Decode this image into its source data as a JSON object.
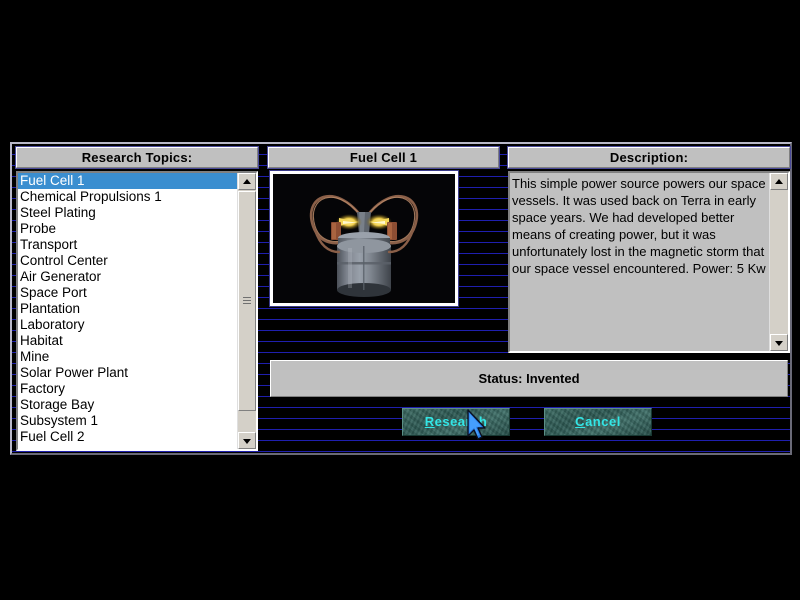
{
  "window": {
    "background_color": "#000000",
    "panel_background_color": "#000000",
    "scanline_color": "#1f1faf",
    "face_color": "#c0c0c0"
  },
  "topics_panel": {
    "header_label": "Research Topics:",
    "selected_index": 0,
    "items": [
      "Fuel Cell 1",
      "Chemical Propulsions 1",
      "Steel Plating",
      "Probe",
      "Transport",
      "Control Center",
      "Air Generator",
      "Space Port",
      "Plantation",
      "Laboratory",
      "Habitat",
      "Mine",
      "Solar Power Plant",
      "Factory",
      "Storage Bay",
      "Subsystem 1",
      "Fuel Cell 2"
    ],
    "scrollbar": {
      "up_arrow_icon": "scroll-up-arrow-icon",
      "down_arrow_icon": "scroll-down-arrow-icon",
      "grip_icon": "scroll-thumb-grip-icon"
    }
  },
  "item_panel": {
    "header_label": "Fuel Cell 1",
    "image_alt": "fuel-cell-render"
  },
  "description_panel": {
    "header_label": "Description:",
    "text": "This simple power source powers our space vessels.  It was used back on Terra in early space years. We had developed better means of creating power, but it was unfortunately lost in the magnetic storm that our space vessel encountered.  Power: 5 Kw",
    "scrollbar": {
      "up_arrow_icon": "scroll-up-arrow-icon",
      "down_arrow_icon": "scroll-down-arrow-icon"
    }
  },
  "status": {
    "label": "Status: Invented"
  },
  "buttons": {
    "research": {
      "accel": "R",
      "rest": "esearch",
      "text_color": "#33e6e6"
    },
    "cancel": {
      "accel": "C",
      "rest": "ancel",
      "text_color": "#33e6e6"
    }
  },
  "cursor": {
    "icon": "mouse-pointer-icon",
    "color": "#2a7fe8"
  }
}
